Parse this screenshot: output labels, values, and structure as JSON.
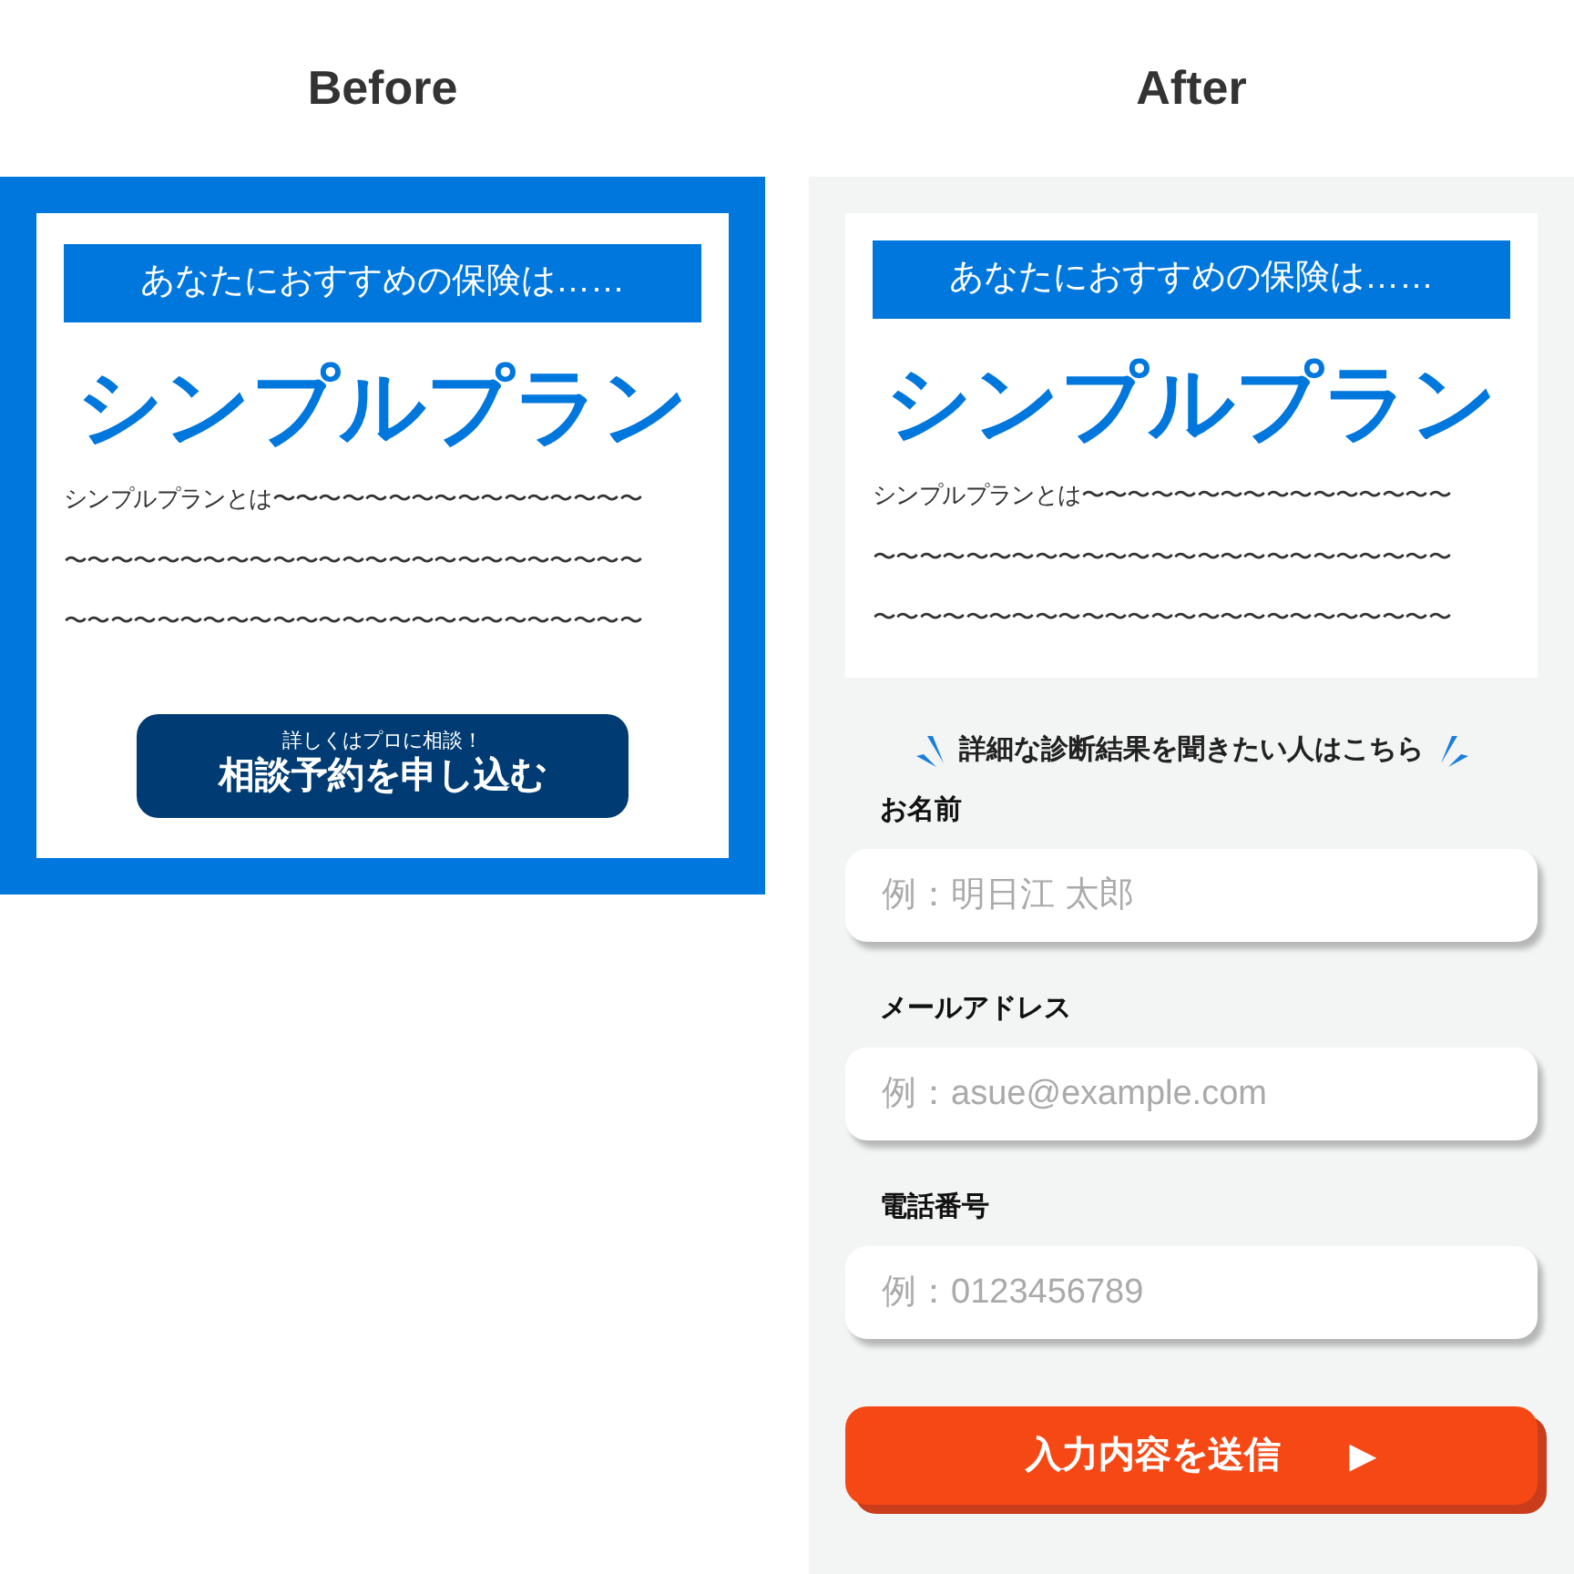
{
  "before": {
    "heading": "Before",
    "card": {
      "banner": "あなたにおすすめの保険は……",
      "title": "シンプルプラン",
      "lines": [
        "シンプルプランとは〜〜〜〜〜〜〜〜〜〜〜〜〜〜〜〜",
        "〜〜〜〜〜〜〜〜〜〜〜〜〜〜〜〜〜〜〜〜〜〜〜〜〜",
        "〜〜〜〜〜〜〜〜〜〜〜〜〜〜〜〜〜〜〜〜〜〜〜〜〜"
      ]
    },
    "button": {
      "caption": "詳しくはプロに相談！",
      "label": "相談予約を申し込む"
    }
  },
  "after": {
    "heading": "After",
    "card": {
      "banner": "あなたにおすすめの保険は……",
      "title": "シンプルプラン",
      "lines": [
        "シンプルプランとは〜〜〜〜〜〜〜〜〜〜〜〜〜〜〜〜",
        "〜〜〜〜〜〜〜〜〜〜〜〜〜〜〜〜〜〜〜〜〜〜〜〜〜",
        "〜〜〜〜〜〜〜〜〜〜〜〜〜〜〜〜〜〜〜〜〜〜〜〜〜"
      ]
    },
    "prompt": "詳細な診断結果を聞きたい人はこちら",
    "fields": [
      {
        "label": "お名前",
        "placeholder": "例：明日江 太郎"
      },
      {
        "label": "メールアドレス",
        "placeholder": "例：asue@example.com"
      },
      {
        "label": "電話番号",
        "placeholder": "例：0123456789"
      }
    ],
    "submit": {
      "label": "入力内容を送信",
      "arrow": "▶"
    }
  }
}
